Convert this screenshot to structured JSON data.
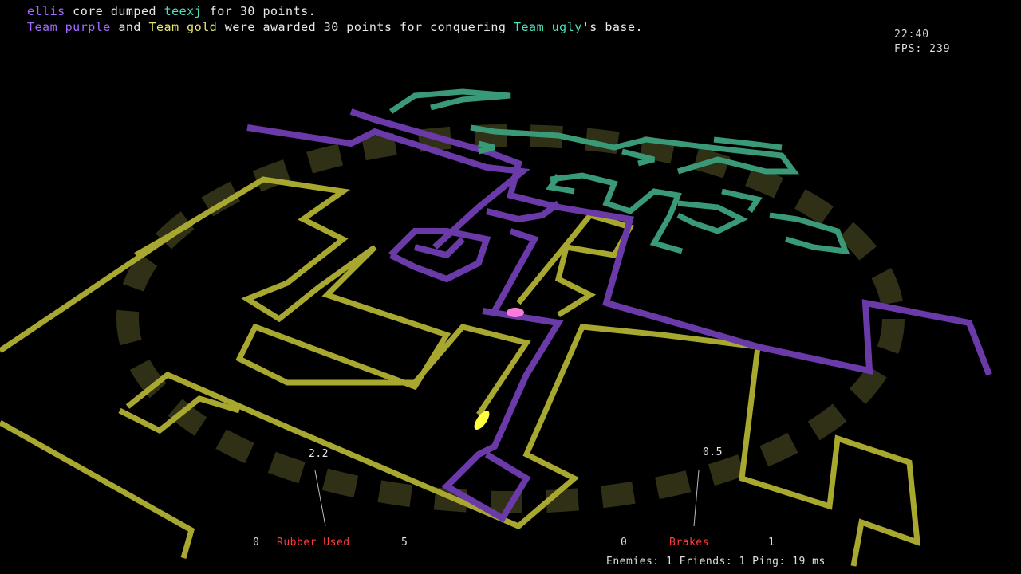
{
  "colors": {
    "purple": "#a26bff",
    "gold": "#d8d84a",
    "ugly": "#4fe0c0",
    "text": "#e8e8e8",
    "wall_gold": "#a8a830",
    "wall_purple": "#6a3aa8",
    "wall_teal": "#3a9a78",
    "gauge_label": "#ff3b3b"
  },
  "messages": {
    "line1": {
      "player1": "ellis",
      "text1": " core dumped ",
      "player2": "teexj",
      "text2": " for 30 points."
    },
    "line2": {
      "team1": "Team purple",
      "text1": " and ",
      "team2": "Team gold",
      "text2": " were awarded 30 points for conquering ",
      "team3": "Team ugly",
      "text3": "'s base."
    }
  },
  "hud": {
    "clock": "22:40",
    "fps": "FPS: 239",
    "rubber": {
      "value": "2.2",
      "min": "0",
      "label": "Rubber Used",
      "max": "5"
    },
    "brakes": {
      "value": "0.5",
      "min": "0",
      "label": "Brakes",
      "max": "1"
    },
    "status": "Enemies: 1 Friends: 1 Ping: 19 ms"
  }
}
